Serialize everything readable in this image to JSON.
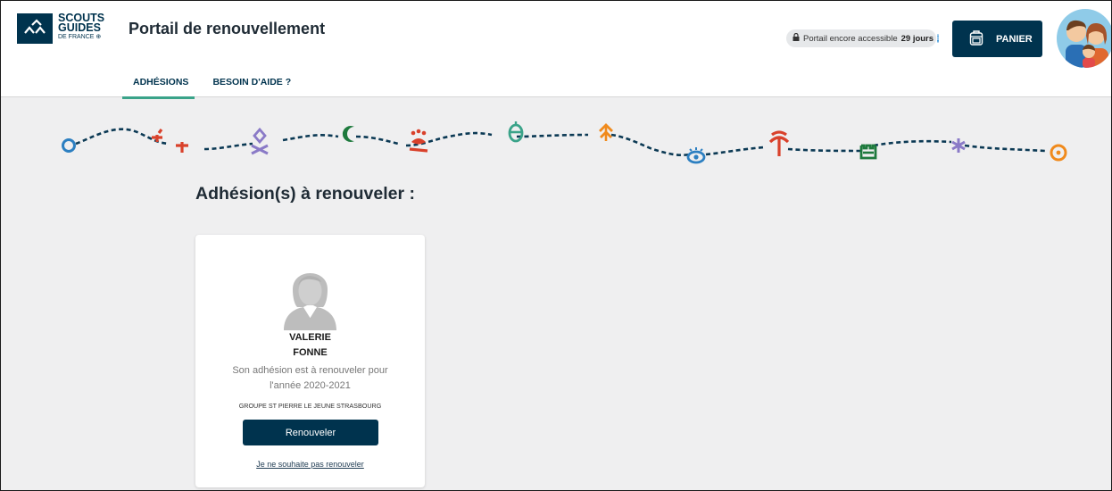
{
  "logo": {
    "line1": "SCOUTS",
    "line2": "GUIDES",
    "line3": "DE FRANCE ⊕"
  },
  "header": {
    "title": "Portail de renouvellement",
    "access_text": "Portail encore accessible",
    "access_days": "29 jours",
    "cart_label": "PANIER"
  },
  "tabs": [
    {
      "label": "ADHÉSIONS",
      "active": true
    },
    {
      "label": "BESOIN D'AIDE ?",
      "active": false
    }
  ],
  "main": {
    "section_title": "Adhésion(s) à renouveler :",
    "card": {
      "first_name": "VALERIE",
      "last_name": "FONNE",
      "renew_text": "Son adhésion est à renouveler pour l'année 2020-2021",
      "group": "GROUPE ST PIERRE LE JEUNE STRASBOURG",
      "renew_button": "Renouveler",
      "decline_link": "Je ne souhaite pas renouveler"
    }
  },
  "colors": {
    "brand": "#00334e",
    "tab_underline": "#3aa389",
    "trail": "#0b3954"
  }
}
